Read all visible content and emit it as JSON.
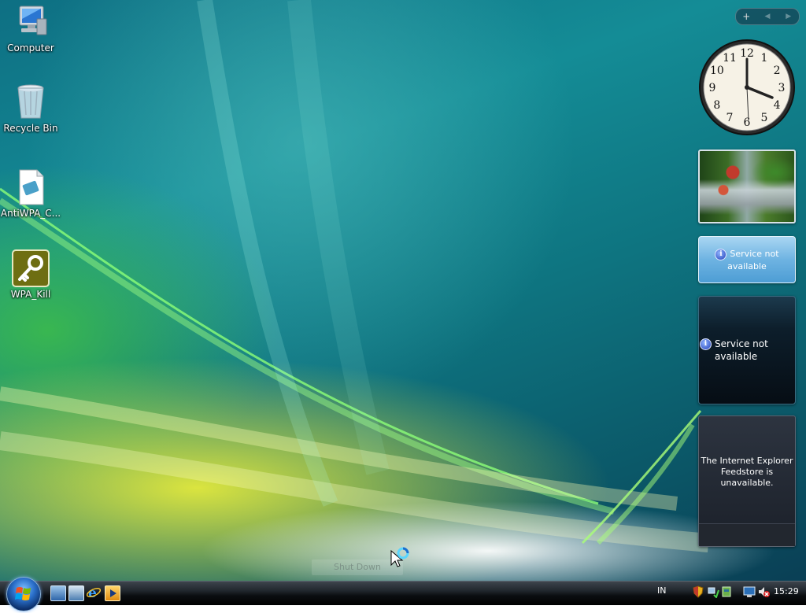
{
  "desktop": {
    "icons": [
      {
        "label": "Computer",
        "icon": "computer-icon"
      },
      {
        "label": "Recycle Bin",
        "icon": "recycle-bin-icon"
      },
      {
        "label": "AntiWPA_C...",
        "icon": "document-icon"
      },
      {
        "label": "WPA_Kill",
        "icon": "key-icon"
      }
    ],
    "shutdown_label": "Shut Down"
  },
  "sidebar": {
    "controls": {
      "add": "+",
      "prev": "◀",
      "next": "▶"
    },
    "clock": {
      "numerals": [
        "12",
        "1",
        "2",
        "3",
        "4",
        "5",
        "6",
        "7",
        "8",
        "9",
        "10",
        "11"
      ],
      "time": "15:29"
    },
    "stocks_message": [
      "Service not",
      "available"
    ],
    "weather_message": [
      "Service not",
      "available"
    ],
    "feeds_message": [
      "The Internet Explorer",
      "Feedstore is",
      "unavailable."
    ]
  },
  "taskbar": {
    "quick_launch": [
      "show-desktop-icon",
      "switch-windows-icon",
      "internet-explorer-icon",
      "media-player-icon"
    ],
    "language": "IN",
    "tray_icons": [
      "security-shield-icon",
      "network-icon",
      "sync-icon",
      "display-icon",
      "volume-muted-icon"
    ],
    "clock": "15:29"
  },
  "colors": {
    "accent": "#148c96",
    "taskbar": "#0b0e11",
    "info": "#2440b8"
  }
}
